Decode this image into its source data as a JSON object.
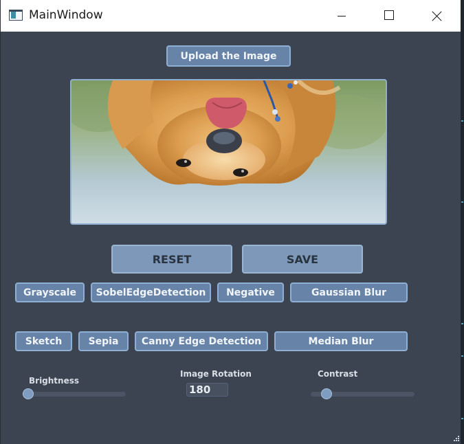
{
  "window": {
    "title": "MainWindow",
    "icon": "app-window-icon",
    "controls": [
      "minimize-icon",
      "maximize-icon",
      "close-icon"
    ]
  },
  "upload_button": "Upload the Image",
  "image_preview": {
    "content": "golden retriever puppy photo, rotated 180 degrees"
  },
  "actions": {
    "reset": "RESET",
    "save": "SAVE"
  },
  "filters_row1": [
    "Grayscale",
    "SobelEdgeDetection",
    "Negative",
    "Gaussian Blur"
  ],
  "filters_row2": [
    "Sketch",
    "Sepia",
    "Canny Edge Detection",
    "Median Blur"
  ],
  "controls": {
    "brightness_label": "Brightness",
    "brightness_value": 0,
    "rotation_label": "Image Rotation",
    "rotation_value": "180",
    "contrast_label": "Contrast",
    "contrast_value": 0.15
  },
  "colors": {
    "background": "#3c4452",
    "button": "#6784a8",
    "button_border": "#8fb0d2",
    "large_button": "#7d98b8"
  }
}
